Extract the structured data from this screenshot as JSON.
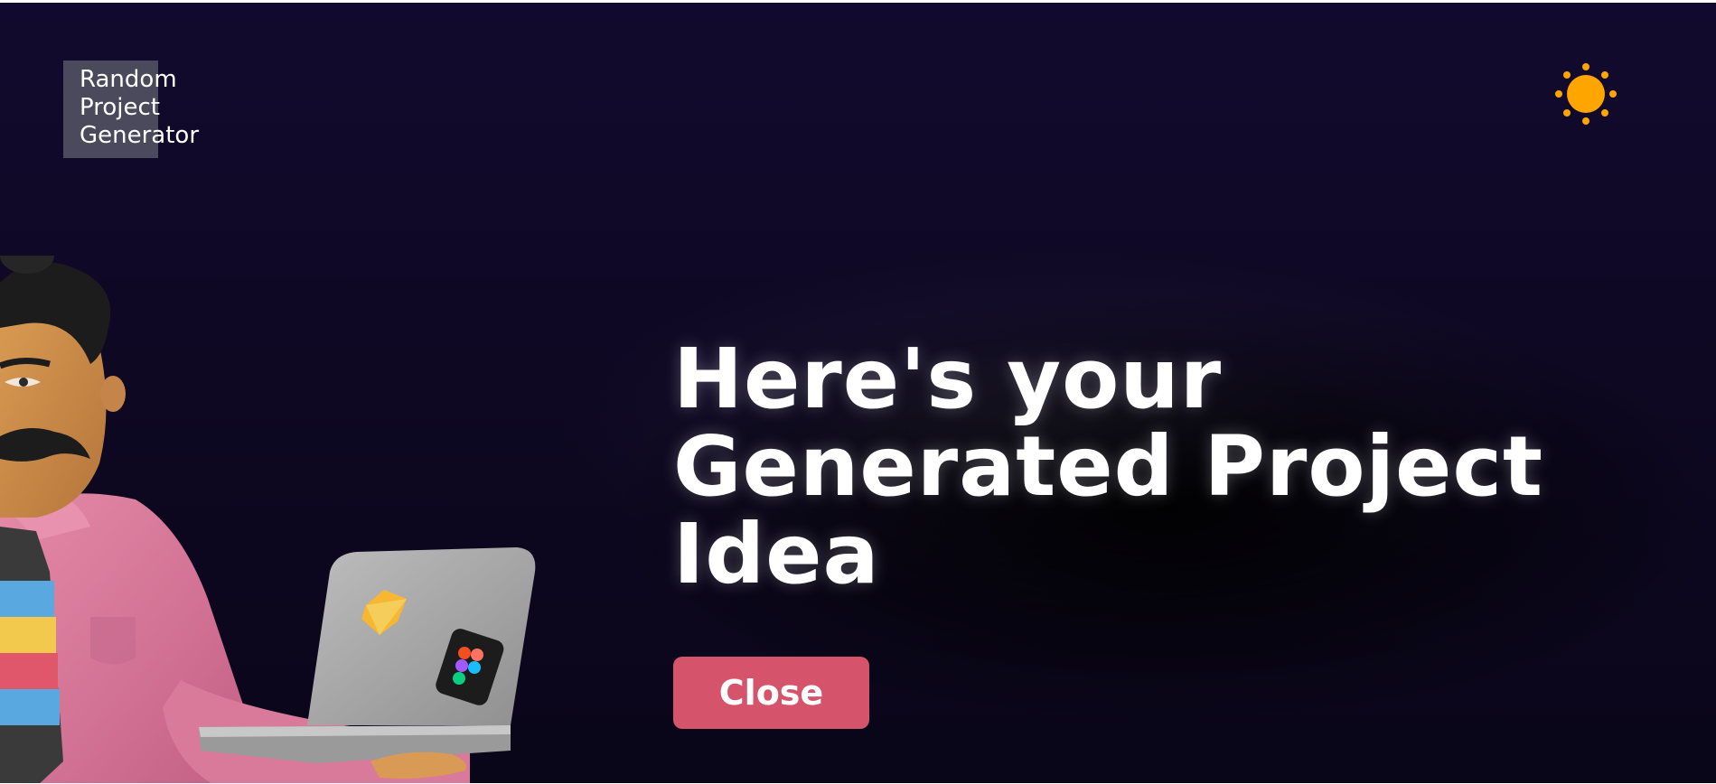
{
  "header": {
    "logo_lines": [
      "Random",
      "Project",
      "Generator"
    ],
    "theme_toggle_icon": "sun-icon"
  },
  "main": {
    "title_lines": [
      "Here's your",
      "Generated Project",
      "Idea"
    ],
    "close_label": "Close"
  },
  "colors": {
    "background": "#0e0823",
    "button": "#d6546b",
    "sun": "#ffa500",
    "logo_bg": "#4b4a5c"
  },
  "illustration": {
    "subject": "developer-with-laptop",
    "stickers": [
      "sketch-icon",
      "figma-icon"
    ]
  }
}
